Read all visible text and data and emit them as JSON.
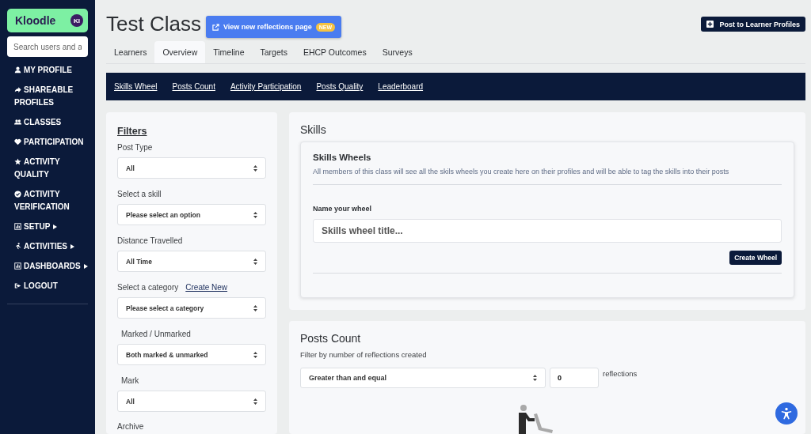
{
  "sidebar": {
    "logo": "Kloodle",
    "avatar": "KI",
    "search": {
      "placeholder": "Search users and a"
    },
    "items": [
      {
        "label": "MY PROFILE",
        "has_submenu": false
      },
      {
        "label": "SHAREABLE PROFILES",
        "has_submenu": false
      },
      {
        "label": "CLASSES",
        "has_submenu": false
      },
      {
        "label": "PARTICIPATION",
        "has_submenu": false
      },
      {
        "label": "ACTIVITY QUALITY",
        "has_submenu": false
      },
      {
        "label": "ACTIVITY VERIFICATION",
        "has_submenu": false
      },
      {
        "label": "SETUP",
        "has_submenu": true
      },
      {
        "label": "ACTIVITIES",
        "has_submenu": true
      },
      {
        "label": "DASHBOARDS",
        "has_submenu": true
      },
      {
        "label": "LOGOUT",
        "has_submenu": false
      }
    ]
  },
  "header": {
    "title": "Test Class",
    "reflections_button": "View new reflections page",
    "badge": "NEW",
    "post_button": "Post to Learner Profiles"
  },
  "tabs": [
    {
      "label": "Learners",
      "selected": false
    },
    {
      "label": "Overview",
      "selected": true
    },
    {
      "label": "Timeline",
      "selected": false
    },
    {
      "label": "Targets",
      "selected": false
    },
    {
      "label": "EHCP Outcomes",
      "selected": false
    },
    {
      "label": "Surveys",
      "selected": false
    }
  ],
  "subnav": [
    "Skills Wheel",
    "Posts Count",
    "Activity Participation",
    "Posts Quality",
    "Leaderboard"
  ],
  "filters": {
    "title": "Filters",
    "groups": [
      {
        "label": "Post Type",
        "value": "All"
      },
      {
        "label": "Select a skill",
        "value": "Please select an option"
      },
      {
        "label": "Distance Travelled",
        "value": "All Time"
      },
      {
        "label": "Select a category",
        "link": "Create New",
        "value": "Please select a category"
      },
      {
        "label": "Marked / Unmarked",
        "value": "Both marked & unmarked"
      },
      {
        "label": "Mark",
        "value": "All"
      }
    ],
    "last_label": "Archive"
  },
  "skills": {
    "title": "Skills",
    "card_title": "Skills Wheels",
    "description": "All members of this class will see all the skils wheels you create here on their profiles and will be able to tag the skills into their posts",
    "field_label": "Name your wheel",
    "placeholder": "Skills wheel title...",
    "button": "Create Wheel"
  },
  "posts_count": {
    "title": "Posts Count",
    "subtitle": "Filter by number of reflections created",
    "comparison": "Greater than and equal",
    "count": "0",
    "unit": "reflections"
  }
}
